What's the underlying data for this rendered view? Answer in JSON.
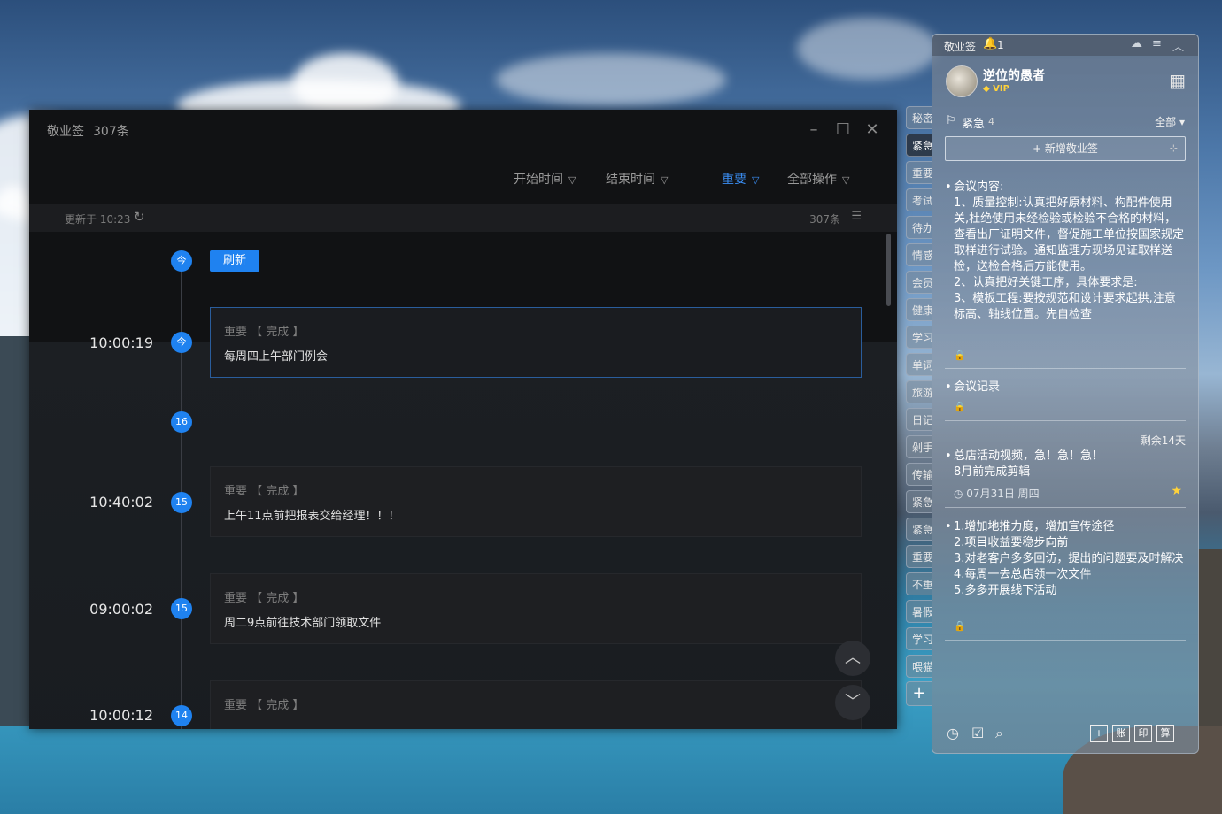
{
  "main_window": {
    "title": "敬业签",
    "count": "307条",
    "filters": {
      "start_time": "开始时间",
      "end_time": "结束时间",
      "importance": "重要",
      "all_actions": "全部操作"
    },
    "status": {
      "updated": "更新于 10:23",
      "total": "307条"
    },
    "timeline": {
      "today_label": "今",
      "refresh_label": "刷新",
      "entries": [
        {
          "time": "10:00:19",
          "day": "今",
          "tag": "重要 【 完成 】",
          "text": "每周四上午部门例会"
        },
        {
          "time": "",
          "day": "16",
          "tag": "",
          "text": ""
        },
        {
          "time": "10:40:02",
          "day": "15",
          "tag": "重要 【 完成 】",
          "text": "上午11点前把报表交给经理！！！"
        },
        {
          "time": "09:00:02",
          "day": "15",
          "tag": "重要 【 完成 】",
          "text": "周二9点前往技术部门领取文件"
        },
        {
          "time": "10:00:12",
          "day": "14",
          "tag": "重要 【 完成 】",
          "text": ""
        }
      ]
    }
  },
  "side_tabs": [
    "秘密",
    "紧急",
    "重要",
    "考试",
    "待办",
    "情感",
    "会员",
    "健康",
    "学习",
    "单词",
    "旅游",
    "日记",
    "剁手",
    "传输",
    "紧急",
    "紧急",
    "重要",
    "不重",
    "暑假",
    "学习",
    "喂猫"
  ],
  "panel": {
    "app_name": "敬业签",
    "notification_count": "1",
    "user_name": "逆位的愚者",
    "vip_label": "VIP",
    "category": {
      "name": "紧急",
      "count": "4",
      "filter": "全部"
    },
    "add_note_label": "+ 新增敬业签",
    "notes": [
      {
        "text": "会议内容:\n1、质量控制:认真把好原材料、构配件使用关,杜绝使用未经检验或检验不合格的材料，查看出厂证明文件，督促施工单位按国家规定取样进行试验。通知监理方现场见证取样送检，送检合格后方能使用。\n2、认真把好关键工序，具体要求是:\n3、模板工程:要按规范和设计要求起拱,注意标高、轴线位置。先自检查"
      },
      {
        "text": "会议记录"
      },
      {
        "remaining": "剩余14天",
        "text": "总店活动视频，急！急！急！\n8月前完成剪辑",
        "date": "07月31日 周四"
      },
      {
        "text": "1.增加地推力度，增加宣传途径\n2.项目收益要稳步向前\n3.对老客户多多回访，提出的问题要及时解决\n4.每周一去总店领一次文件\n5.多多开展线下活动"
      }
    ],
    "bottom_tools": [
      "账",
      "印",
      "算"
    ]
  }
}
